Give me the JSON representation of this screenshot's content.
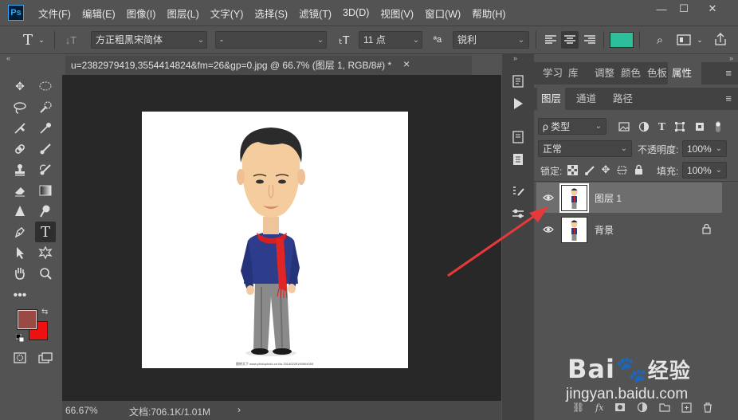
{
  "app": {
    "logo": "Ps"
  },
  "menu": [
    "文件(F)",
    "编辑(E)",
    "图像(I)",
    "图层(L)",
    "文字(Y)",
    "选择(S)",
    "滤镜(T)",
    "3D(D)",
    "视图(V)",
    "窗口(W)",
    "帮助(H)"
  ],
  "window_controls": {
    "minimize": "—",
    "maximize": "☐",
    "close": "✕"
  },
  "options": {
    "tool_icon": "T",
    "font_family": "方正粗黑宋简体",
    "font_style": "-",
    "font_size": "11 点",
    "antialias_icon": "ªa",
    "antialias": "锐利",
    "text_color": "#2dbf9a"
  },
  "document": {
    "tab_title": "u=2382979419,3554414824&fm=26&gp=0.jpg @ 66.7% (图层 1, RGB/8#) *",
    "tab_close": "×",
    "caption": "图转天下  www.photophoto.cn  No.20140229190904000"
  },
  "status": {
    "zoom": "66.67%",
    "doc_info": "文档:706.1K/1.01M",
    "arrow": "›"
  },
  "colors": {
    "foreground": "#9a4a44",
    "background": "#ee1111",
    "accent_arrow": "#e8393a"
  },
  "panels": {
    "top_tabs": [
      "学习",
      "库",
      "调整",
      "颜色",
      "色板",
      "属性"
    ],
    "layer_tabs": [
      "图层",
      "通道",
      "路径"
    ],
    "filter_label": "ρ 类型",
    "blend_mode": "正常",
    "opacity_label": "不透明度:",
    "opacity_value": "100%",
    "lock_label": "锁定:",
    "fill_label": "填充:",
    "fill_value": "100%",
    "layers": [
      {
        "name": "图层 1",
        "locked": false
      },
      {
        "name": "背景",
        "locked": true
      }
    ]
  },
  "watermark": {
    "brand": "Bai",
    "brand2": "经验",
    "url": "jingyan.baidu.com"
  }
}
